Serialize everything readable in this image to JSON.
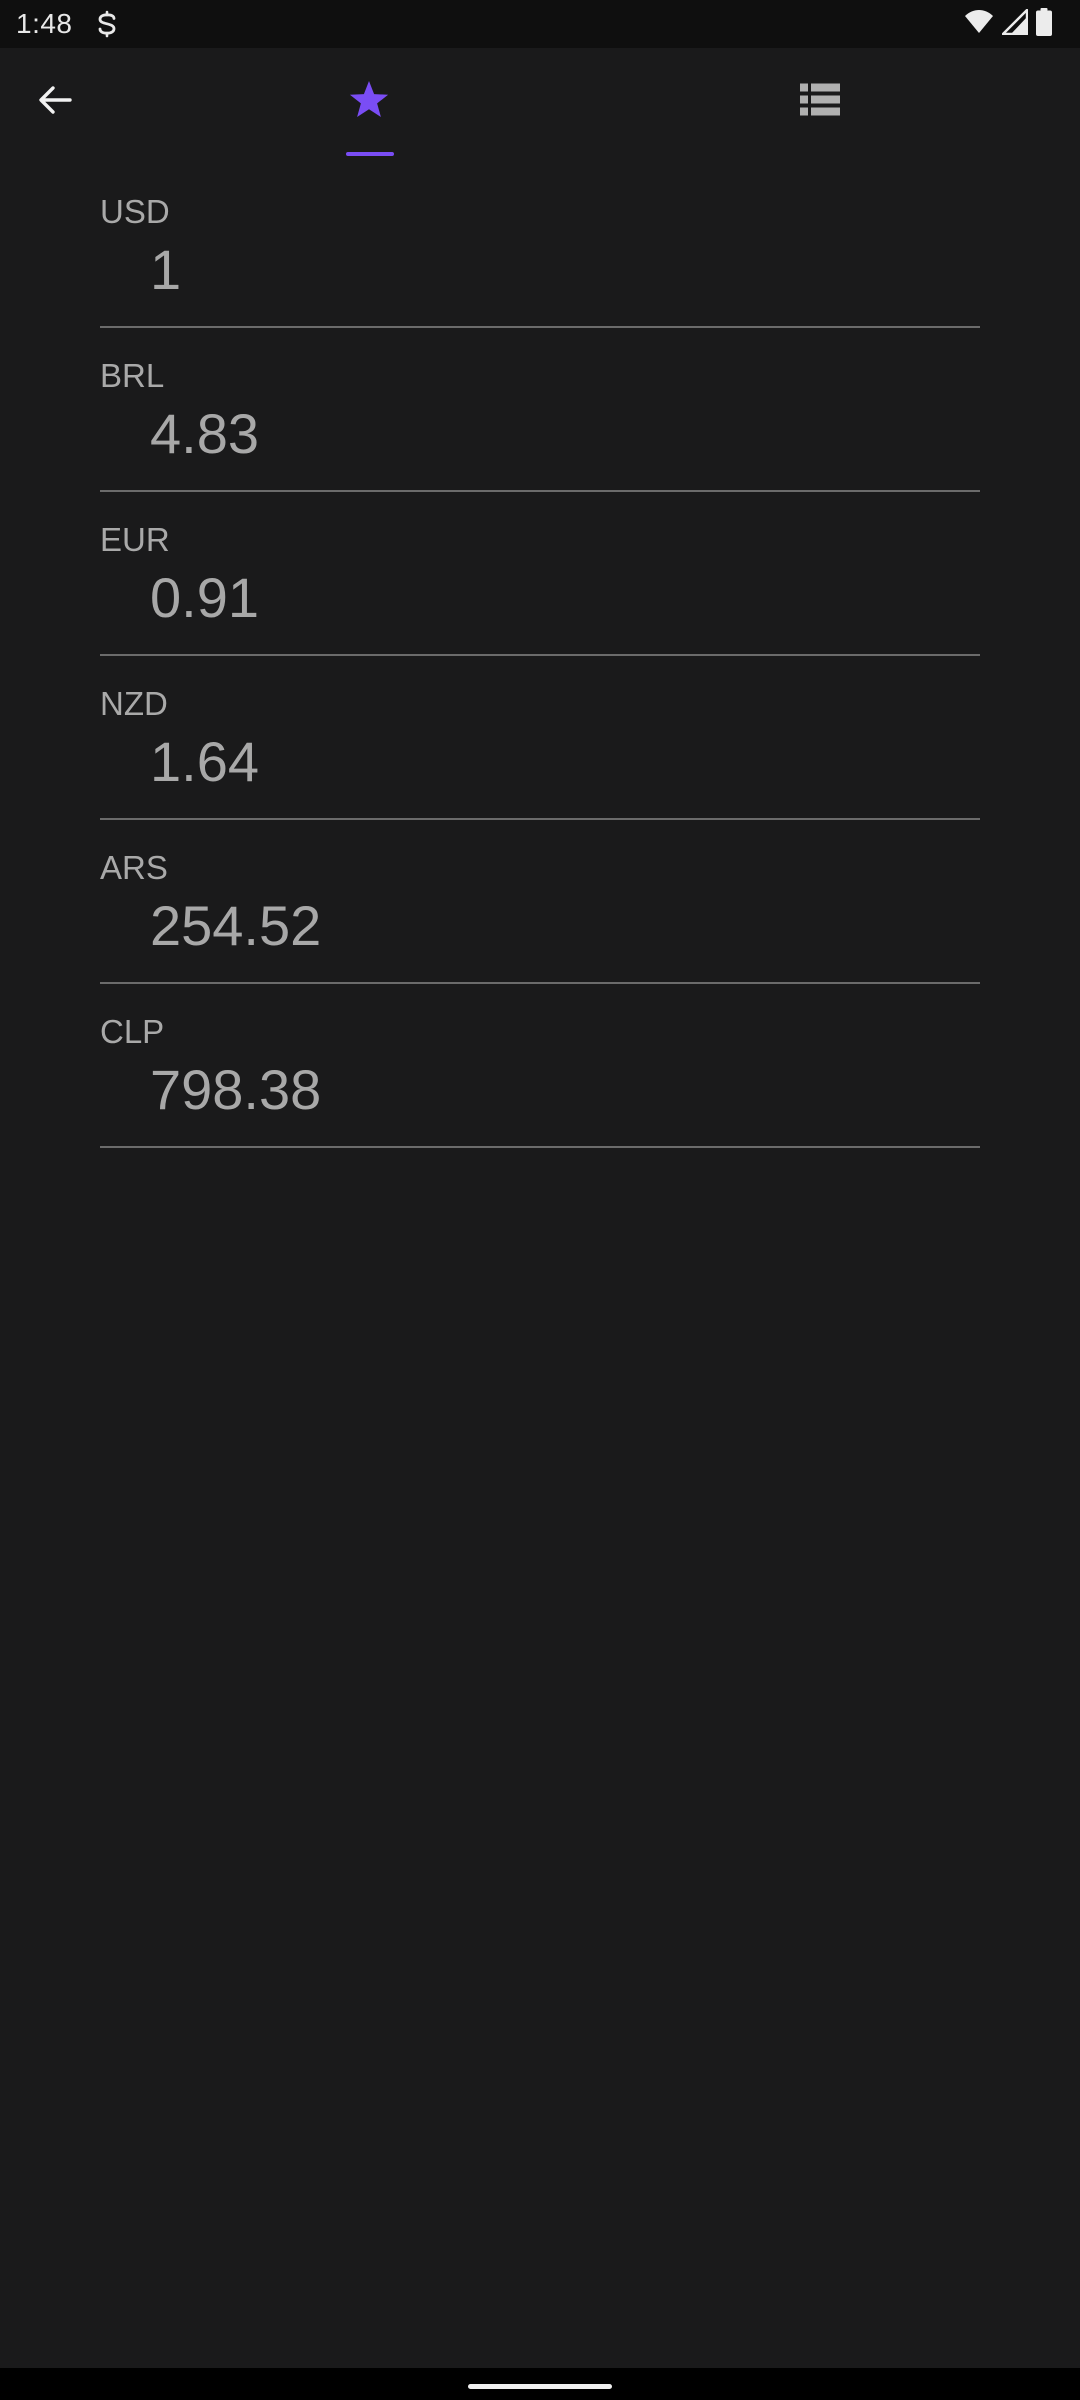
{
  "status_bar": {
    "time": "1:48",
    "app_icon": "s-notification-icon",
    "wifi_icon": "wifi-icon",
    "signal_icon": "signal-icon",
    "battery_icon": "battery-icon"
  },
  "toolbar": {
    "back_icon": "arrow-back-icon",
    "tabs": [
      {
        "icon": "star-icon",
        "selected": true
      },
      {
        "icon": "list-icon",
        "selected": false
      }
    ]
  },
  "currencies": [
    {
      "code": "USD",
      "value": "1"
    },
    {
      "code": "BRL",
      "value": "4.83"
    },
    {
      "code": "EUR",
      "value": "0.91"
    },
    {
      "code": "NZD",
      "value": "1.64"
    },
    {
      "code": "ARS",
      "value": "254.52"
    },
    {
      "code": "CLP",
      "value": "798.38"
    }
  ],
  "colors": {
    "accent": "#7a4df5",
    "background": "#1a1a1b",
    "divider": "#6b6b6b",
    "text": "#a8a8a8",
    "inactive_icon": "#b0b0b0"
  }
}
